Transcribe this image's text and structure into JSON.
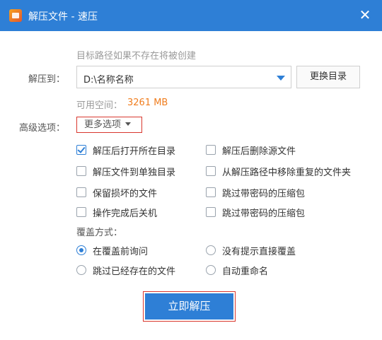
{
  "window": {
    "title": "解压文件 - 速压",
    "close_glyph": "✕"
  },
  "hint": "目标路径如果不存在将被创建",
  "extract_to": {
    "label": "解压到：",
    "path": "D:\\名称名称",
    "change_button": "更换目录"
  },
  "space": {
    "label": "可用空间：",
    "value": "3261 MB",
    "value_color": "#f07d1e"
  },
  "advanced": {
    "label": "高级选项：",
    "more_button": "更多选项"
  },
  "options_left": [
    {
      "label": "解压后打开所在目录",
      "checked": true
    },
    {
      "label": "解压文件到单独目录",
      "checked": false
    },
    {
      "label": "保留损坏的文件",
      "checked": false
    },
    {
      "label": "操作完成后关机",
      "checked": false
    }
  ],
  "options_right": [
    {
      "label": "解压后删除源文件",
      "checked": false
    },
    {
      "label": "从解压路径中移除重复的文件夹",
      "checked": false
    },
    {
      "label": "跳过带密码的压缩包",
      "checked": false
    },
    {
      "label": "跳过带密码的压缩包",
      "checked": false
    }
  ],
  "overwrite": {
    "label": "覆盖方式：",
    "options": [
      {
        "label": "在覆盖前询问",
        "selected": true
      },
      {
        "label": "没有提示直接覆盖",
        "selected": false
      },
      {
        "label": "跳过已经存在的文件",
        "selected": false
      },
      {
        "label": "自动重命名",
        "selected": false
      }
    ]
  },
  "start_button": "立即解压",
  "colors": {
    "accent": "#2e7fd6",
    "highlight_border": "#d9372e"
  }
}
